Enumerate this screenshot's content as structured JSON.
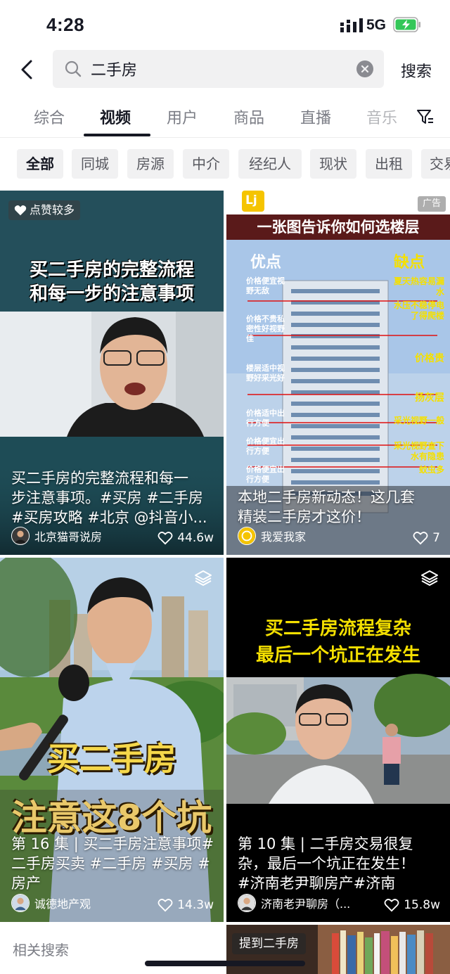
{
  "status": {
    "time": "4:28",
    "network": "5G"
  },
  "search": {
    "query": "二手房",
    "button_label": "搜索"
  },
  "tabs": [
    {
      "label": "综合"
    },
    {
      "label": "视频"
    },
    {
      "label": "用户"
    },
    {
      "label": "商品"
    },
    {
      "label": "直播"
    },
    {
      "label": "音乐"
    }
  ],
  "chips": [
    "全部",
    "同城",
    "房源",
    "中介",
    "经纪人",
    "现状",
    "出租",
    "交易"
  ],
  "cards": [
    {
      "badge": "点赞较多",
      "overlay_line1": "买二手房的完整流程",
      "overlay_line2": "和每一步的注意事项",
      "caption_line1": "买二手房的完整流程和每一",
      "caption_line2": "步注意事项。#买房 #二手房",
      "caption_line3": "#买房攻略 #北京 @抖音小...",
      "author": "北京猫哥说房",
      "likes": "44.6w"
    },
    {
      "ad_label": "广告",
      "banner": "一张图告诉你如何选楼层",
      "left_header": "优点",
      "right_header": "缺点",
      "left_notes": [
        "价格便宜视野无敌",
        "价格不贵私密性好视野佳",
        "楼层适中视野好采光好",
        "价格适中出行方便",
        "价格便宜出行方便",
        "价格便宜出行方便"
      ],
      "right_notes": [
        "夏天热容易漏水",
        "水压不稳停电了得爬楼",
        "价格贵",
        "扬灰层",
        "采光视野一般",
        "采光视野查下水有隐患",
        "蚊虫多"
      ],
      "caption_line1": "本地二手房新动态！这几套",
      "caption_line2": "精装二手房才这价！",
      "author": "我爱我家",
      "likes": "7"
    },
    {
      "overlay_line1": "买二手房",
      "overlay_line2": "注意这8个坑",
      "caption_line1": "第 16 集 | 买二手房注意事项#",
      "caption_line2": "二手房买卖 #二手房 #买房 #",
      "caption_line3": "房产",
      "author": "诚德地产观",
      "likes": "14.3w"
    },
    {
      "overlay_line1": "买二手房流程复杂",
      "overlay_line2": "最后一个坑正在发生",
      "caption_line1": "第 10 集 | 二手房交易很复",
      "caption_line2": "杂，最后一个坑正在发生！",
      "caption_line3": "#济南老尹聊房产#济南",
      "author": "济南老尹聊房（...",
      "likes": "15.8w"
    }
  ],
  "related_label": "相关搜索",
  "mention_chip": "提到二手房"
}
